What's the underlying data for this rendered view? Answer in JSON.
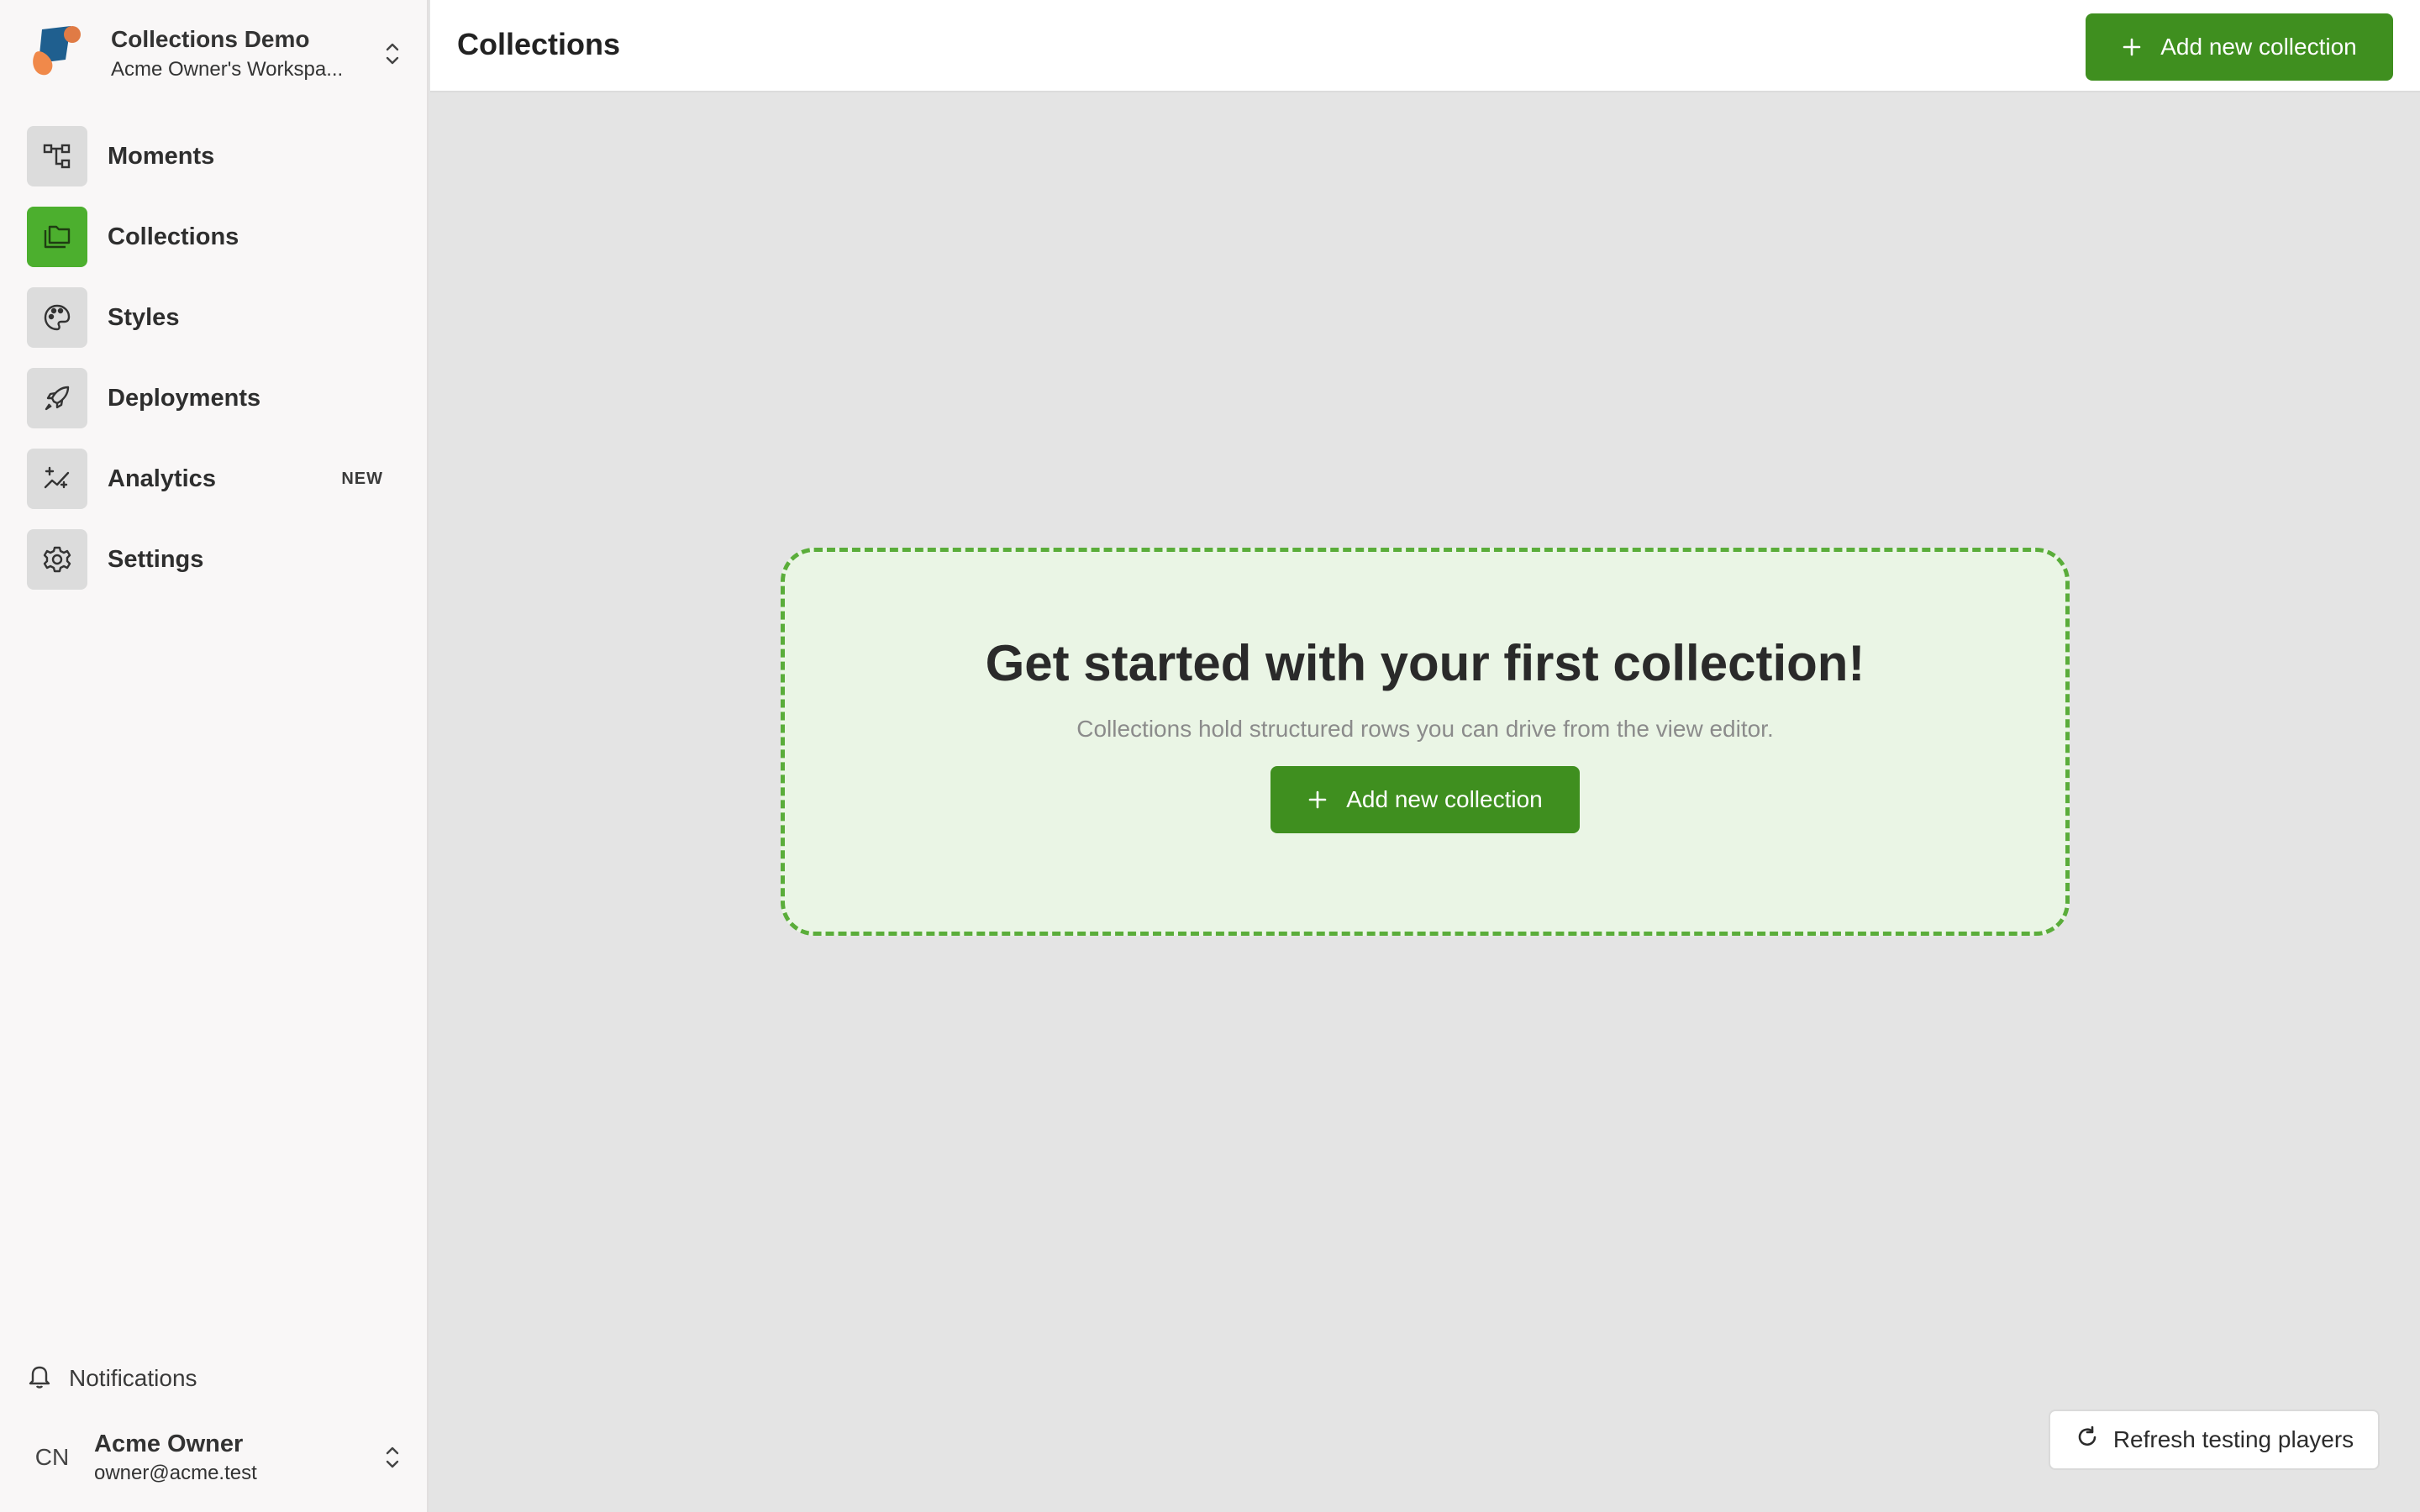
{
  "workspace": {
    "name": "Collections Demo",
    "subtitle": "Acme Owner's Workspa..."
  },
  "sidebar": {
    "items": [
      {
        "label": "Moments",
        "icon": "flow-icon"
      },
      {
        "label": "Collections",
        "icon": "folder-icon",
        "active": true
      },
      {
        "label": "Styles",
        "icon": "palette-icon"
      },
      {
        "label": "Deployments",
        "icon": "rocket-icon"
      },
      {
        "label": "Analytics",
        "icon": "sparkle-chart-icon",
        "badge": "NEW"
      },
      {
        "label": "Settings",
        "icon": "gear-icon"
      }
    ],
    "notifications_label": "Notifications",
    "user": {
      "initials": "CN",
      "name": "Acme Owner",
      "email": "owner@acme.test"
    }
  },
  "header": {
    "title": "Collections",
    "add_button_label": "Add new collection"
  },
  "empty_state": {
    "title": "Get started with your first collection!",
    "description": "Collections hold structured rows you can drive from the view editor.",
    "button_label": "Add new collection"
  },
  "refresh_button_label": "Refresh testing players",
  "colors": {
    "accent": "#3f8f1f",
    "active_nav": "#4caf2e",
    "empty_bg": "#eaf5e5",
    "empty_border": "#5aad3a"
  }
}
